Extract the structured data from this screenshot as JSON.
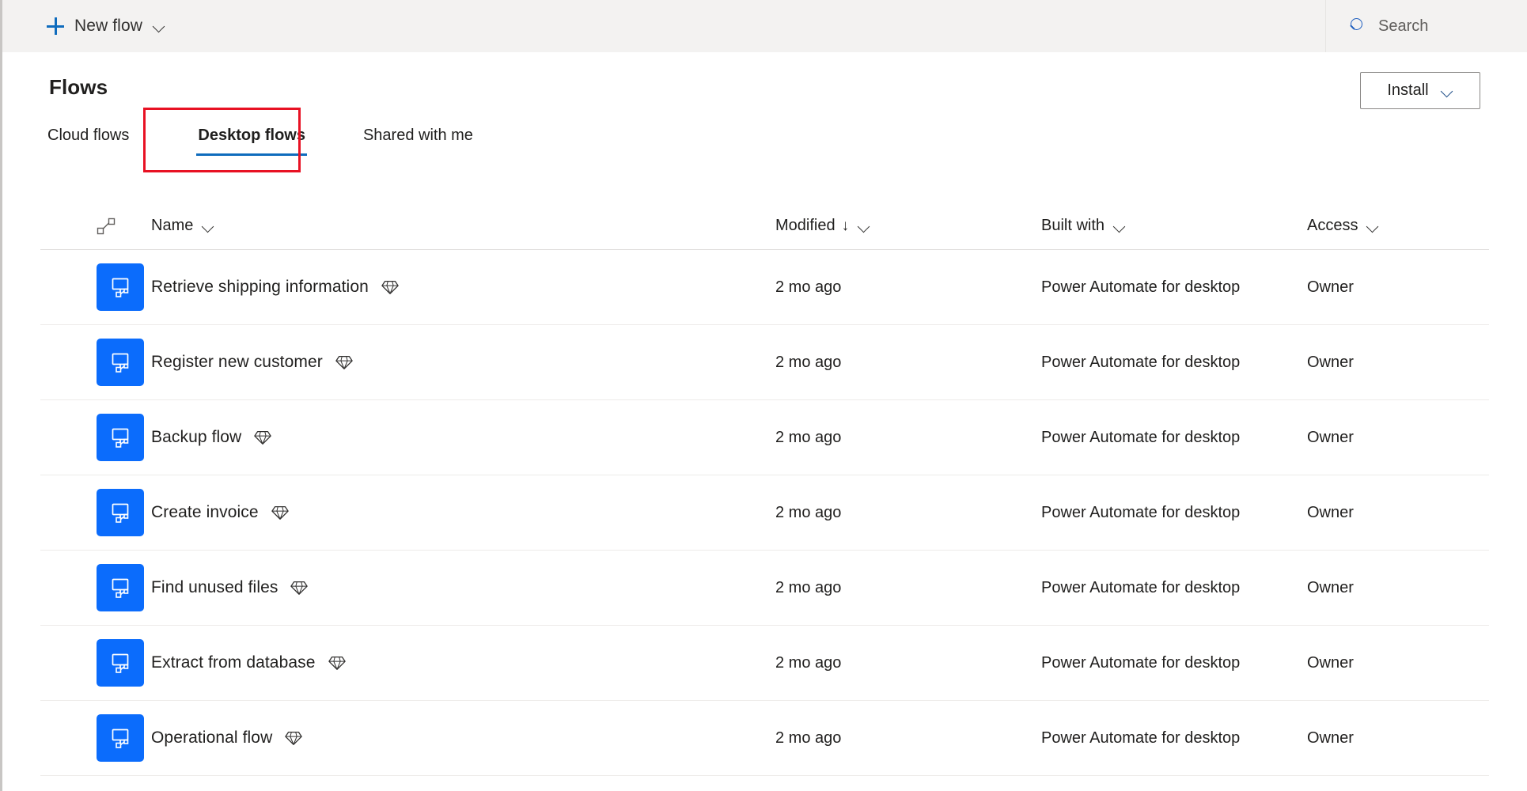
{
  "colors": {
    "accent": "#0f6cbd",
    "tile_blue": "#0b6cfc",
    "highlight_red": "#e81123",
    "command_bar_bg": "#f3f2f1",
    "text": "#201f1e",
    "muted_text": "#605e5c",
    "row_divider": "#edebe9"
  },
  "command_bar": {
    "new_flow_label": "New flow",
    "new_flow_icon": "plus-icon",
    "new_flow_chevron_icon": "chevron-down-icon",
    "search_icon": "search-icon",
    "search_placeholder": "Search",
    "search_value": ""
  },
  "header": {
    "title": "Flows",
    "install_label": "Install",
    "install_chevron_icon": "chevron-down-icon"
  },
  "tabs": [
    {
      "label": "Cloud flows",
      "selected": false
    },
    {
      "label": "Desktop flows",
      "selected": true
    },
    {
      "label": "Shared with me",
      "selected": false
    }
  ],
  "annotation": {
    "type": "red-highlight-rectangle",
    "targets_tab": "Desktop flows"
  },
  "table": {
    "columns": [
      {
        "key": "type",
        "label": "",
        "icon": "flow-connector-icon",
        "sortable": true
      },
      {
        "key": "name",
        "label": "Name",
        "chevron_icon": "chevron-down-icon",
        "sortable": true
      },
      {
        "key": "modified",
        "label": "Modified",
        "sort_arrow": "↓",
        "chevron_icon": "chevron-down-icon",
        "sortable": true
      },
      {
        "key": "built_with",
        "label": "Built with",
        "chevron_icon": "chevron-down-icon",
        "sortable": true
      },
      {
        "key": "access",
        "label": "Access",
        "chevron_icon": "chevron-down-icon",
        "sortable": true
      }
    ],
    "rows": [
      {
        "icon": "desktop-flow-icon",
        "name": "Retrieve shipping information",
        "badge_icon": "premium-diamond-icon",
        "modified": "2 mo ago",
        "built_with": "Power Automate for desktop",
        "access": "Owner"
      },
      {
        "icon": "desktop-flow-icon",
        "name": "Register new customer",
        "badge_icon": "premium-diamond-icon",
        "modified": "2 mo ago",
        "built_with": "Power Automate for desktop",
        "access": "Owner"
      },
      {
        "icon": "desktop-flow-icon",
        "name": "Backup flow",
        "badge_icon": "premium-diamond-icon",
        "modified": "2 mo ago",
        "built_with": "Power Automate for desktop",
        "access": "Owner"
      },
      {
        "icon": "desktop-flow-icon",
        "name": "Create invoice",
        "badge_icon": "premium-diamond-icon",
        "modified": "2 mo ago",
        "built_with": "Power Automate for desktop",
        "access": "Owner"
      },
      {
        "icon": "desktop-flow-icon",
        "name": "Find unused files",
        "badge_icon": "premium-diamond-icon",
        "modified": "2 mo ago",
        "built_with": "Power Automate for desktop",
        "access": "Owner"
      },
      {
        "icon": "desktop-flow-icon",
        "name": "Extract from database",
        "badge_icon": "premium-diamond-icon",
        "modified": "2 mo ago",
        "built_with": "Power Automate for desktop",
        "access": "Owner"
      },
      {
        "icon": "desktop-flow-icon",
        "name": "Operational flow",
        "badge_icon": "premium-diamond-icon",
        "modified": "2 mo ago",
        "built_with": "Power Automate for desktop",
        "access": "Owner"
      }
    ]
  }
}
